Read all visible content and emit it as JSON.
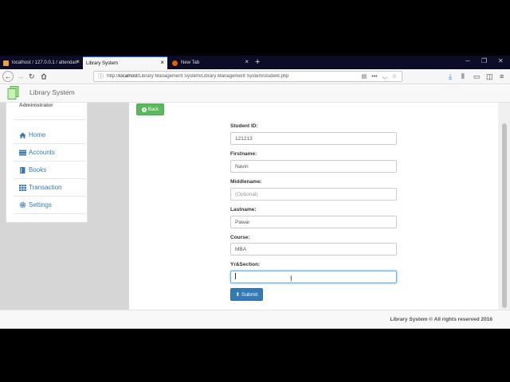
{
  "browser": {
    "tabs": [
      {
        "label": "localhost / 127.0.0.1 / attendan"
      },
      {
        "label": "Library System"
      },
      {
        "label": "New Tab"
      }
    ],
    "url_prefix": "http://",
    "url_host": "localhost",
    "url_path": "/Library Management System/Library Management System/student.php",
    "new_tab_glyph": "+",
    "close_glyph": "×"
  },
  "app": {
    "brand": "Library System",
    "role": "Administrator"
  },
  "sidebar": {
    "items": [
      {
        "label": "Home",
        "icon": "home-icon"
      },
      {
        "label": "Accounts",
        "icon": "list-icon"
      },
      {
        "label": "Books",
        "icon": "book-icon"
      },
      {
        "label": "Transaction",
        "icon": "grid-icon"
      },
      {
        "label": "Settings",
        "icon": "gear-icon"
      }
    ]
  },
  "buttons": {
    "back": "Back",
    "submit": "Submit"
  },
  "form": {
    "fields": [
      {
        "label": "Student ID:",
        "value": "121213",
        "placeholder": ""
      },
      {
        "label": "Firstname:",
        "value": "Navin",
        "placeholder": ""
      },
      {
        "label": "Middlename:",
        "value": "",
        "placeholder": "(Optional)"
      },
      {
        "label": "Lastname:",
        "value": "Pawar",
        "placeholder": ""
      },
      {
        "label": "Course:",
        "value": "MBA",
        "placeholder": ""
      },
      {
        "label": "Yr&Section:",
        "value": "",
        "placeholder": ""
      }
    ]
  },
  "footer": {
    "text": "Library System © All rights reserved 2016"
  },
  "colors": {
    "accent": "#337ab7",
    "success": "#5cb85c",
    "tabbar": "#0c0c26"
  }
}
